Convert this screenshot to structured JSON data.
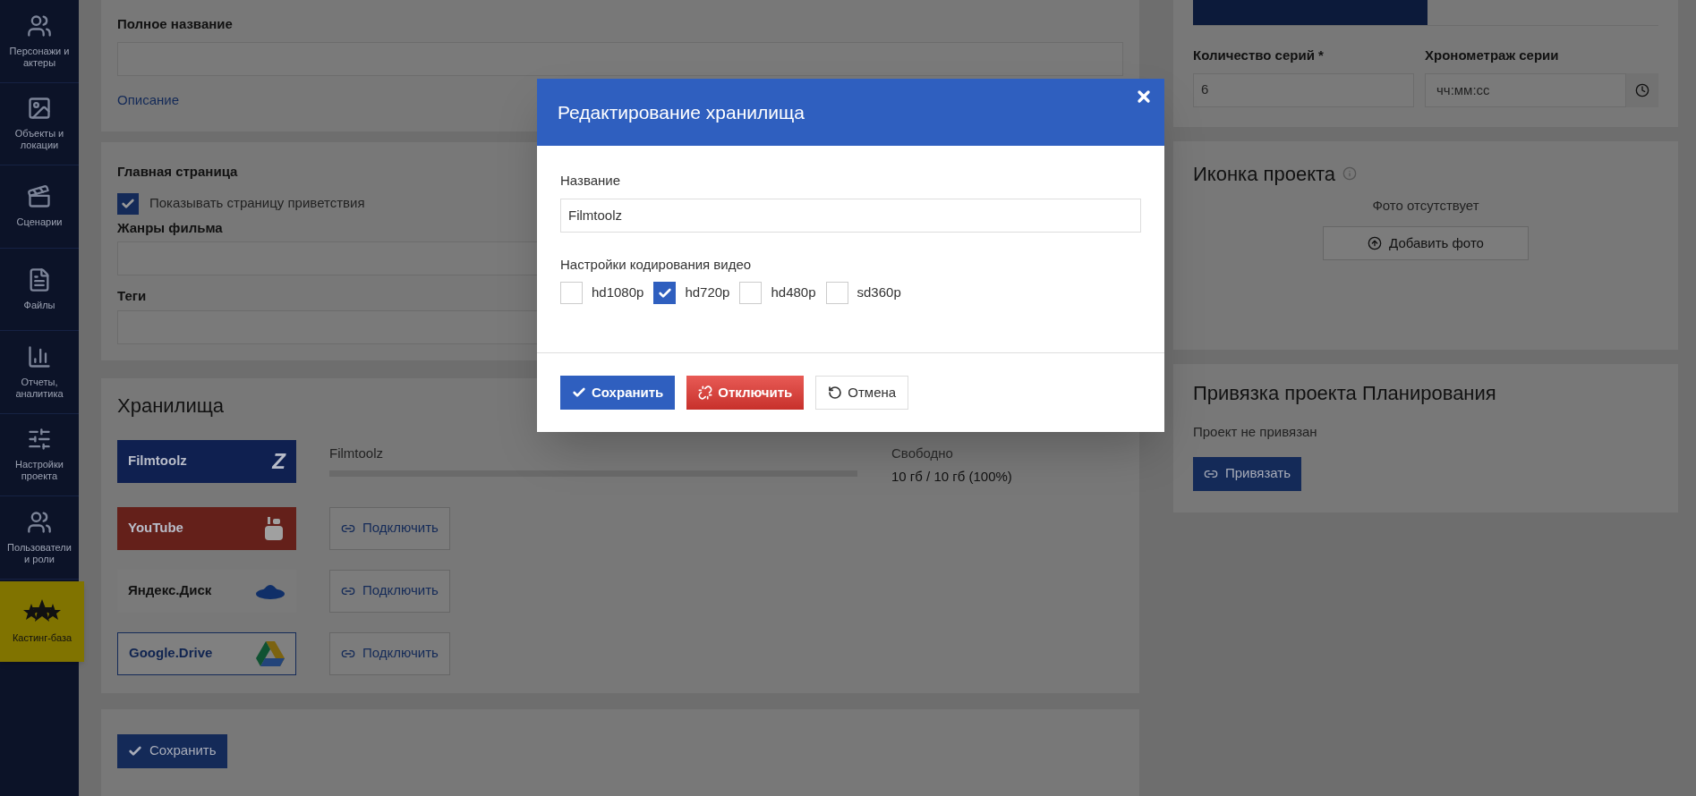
{
  "sidebar": {
    "items": [
      {
        "label": "Персонажи и актеры",
        "selected": false
      },
      {
        "label": "Объекты и локации",
        "selected": false
      },
      {
        "label": "Сценарии",
        "selected": false
      },
      {
        "label": "Файлы",
        "selected": false
      },
      {
        "label": "Отчеты, аналитика",
        "selected": false
      },
      {
        "label": "Настройки проекта",
        "selected": false
      },
      {
        "label": "Пользователи и роли",
        "selected": false
      },
      {
        "label": "Кастинг-база",
        "selected": true
      }
    ]
  },
  "main": {
    "full_name": {
      "label": "Полное название"
    },
    "description_link": "Описание",
    "home": {
      "heading": "Главная страница",
      "checkbox": {
        "label": "Показывать страницу приветствия",
        "checked": true
      }
    },
    "genres": {
      "label": "Жанры фильма"
    },
    "tags": {
      "label": "Теги"
    },
    "storages": {
      "heading": "Хранилища",
      "items": [
        {
          "name": "Filmtoolz",
          "logo_text": "Z",
          "color": "#0f2050",
          "outlined": false,
          "connected": true,
          "storage_name": "Filmtoolz",
          "level": 0,
          "free_label": "Свободно",
          "free_value": "10 гб / 10 гб (100%)"
        },
        {
          "name": "YouTube",
          "color": "#64201a",
          "outlined": false,
          "connected": false,
          "connect_button": "Подключить"
        },
        {
          "name": "Яндекс.Диск",
          "color": "#7a7a7a",
          "outlined": false,
          "connected": false,
          "connect_button": "Подключить"
        },
        {
          "name": "Google.Drive",
          "color": "#808080",
          "outlined": true,
          "connected": false,
          "connect_button": "Подключить"
        }
      ]
    },
    "save_button": "Сохранить"
  },
  "right": {
    "episodes": {
      "label": "Количество серий",
      "required_mark": "*",
      "value": "6"
    },
    "duration": {
      "label": "Хронометраж серии",
      "placeholder": "чч:мм:сс"
    },
    "project_icon": {
      "heading": "Иконка проекта",
      "empty_text": "Фото отсутствует",
      "add_button": "Добавить фото"
    },
    "planning": {
      "heading": "Привязка проекта Планирования",
      "status": "Проект не привязан",
      "button": "Привязать"
    }
  },
  "modal": {
    "title": "Редактирование хранилища",
    "name_label": "Название",
    "name_value": "Filmtoolz",
    "encoding_label": "Настройки кодирования видео",
    "options": [
      {
        "label": "hd1080p",
        "checked": false
      },
      {
        "label": "hd720p",
        "checked": true
      },
      {
        "label": "hd480p",
        "checked": false
      },
      {
        "label": "sd360p",
        "checked": false
      }
    ],
    "buttons": [
      {
        "label": "Сохранить",
        "kind": "primary"
      },
      {
        "label": "Отключить",
        "kind": "danger"
      },
      {
        "label": "Отмена",
        "kind": "default"
      }
    ]
  }
}
